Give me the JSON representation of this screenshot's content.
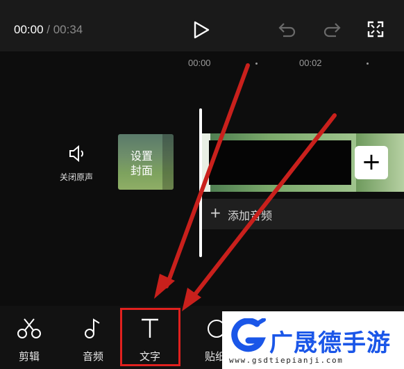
{
  "player": {
    "current_time": "00:00",
    "separator": " / ",
    "total_time": "00:34",
    "play_icon": "play-icon",
    "undo_icon": "undo-icon",
    "redo_icon": "redo-icon",
    "fullscreen_icon": "fullscreen-icon"
  },
  "ruler": {
    "ticks": [
      "00:00",
      "00:02"
    ]
  },
  "timeline": {
    "mute_label": "关闭原声",
    "cover_label": "设置\n封面",
    "add_audio_label": "添加音频",
    "add_clip_symbol": "+",
    "add_audio_symbol": "+"
  },
  "toolbar": {
    "items": [
      {
        "label": "剪辑",
        "icon": "scissors-icon"
      },
      {
        "label": "音频",
        "icon": "music-note-icon"
      },
      {
        "label": "文字",
        "icon": "text-icon"
      },
      {
        "label": "贴纸",
        "icon": "sticker-icon"
      }
    ]
  },
  "watermark": {
    "brand": "广晟德手游",
    "url": "www.gsdtiepianji.com"
  },
  "colors": {
    "highlight": "#e0201e",
    "brand": "#1a56e8"
  }
}
